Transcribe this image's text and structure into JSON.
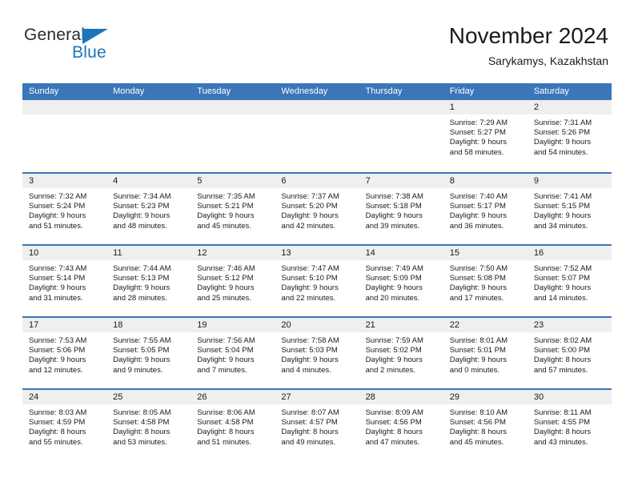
{
  "brand": {
    "word1": "General",
    "word2": "Blue",
    "accent": "#1a75bb"
  },
  "header": {
    "title": "November 2024",
    "location": "Sarykamys, Kazakhstan"
  },
  "theme": {
    "header_blue": "#3a76b8",
    "cell_head_gray": "#efefef"
  },
  "weekdays": [
    "Sunday",
    "Monday",
    "Tuesday",
    "Wednesday",
    "Thursday",
    "Friday",
    "Saturday"
  ],
  "weeks": [
    [
      {
        "day": "",
        "empty": true
      },
      {
        "day": "",
        "empty": true
      },
      {
        "day": "",
        "empty": true
      },
      {
        "day": "",
        "empty": true
      },
      {
        "day": "",
        "empty": true
      },
      {
        "day": "1",
        "sunrise": "Sunrise: 7:29 AM",
        "sunset": "Sunset: 5:27 PM",
        "daylight1": "Daylight: 9 hours",
        "daylight2": "and 58 minutes."
      },
      {
        "day": "2",
        "sunrise": "Sunrise: 7:31 AM",
        "sunset": "Sunset: 5:26 PM",
        "daylight1": "Daylight: 9 hours",
        "daylight2": "and 54 minutes."
      }
    ],
    [
      {
        "day": "3",
        "sunrise": "Sunrise: 7:32 AM",
        "sunset": "Sunset: 5:24 PM",
        "daylight1": "Daylight: 9 hours",
        "daylight2": "and 51 minutes."
      },
      {
        "day": "4",
        "sunrise": "Sunrise: 7:34 AM",
        "sunset": "Sunset: 5:23 PM",
        "daylight1": "Daylight: 9 hours",
        "daylight2": "and 48 minutes."
      },
      {
        "day": "5",
        "sunrise": "Sunrise: 7:35 AM",
        "sunset": "Sunset: 5:21 PM",
        "daylight1": "Daylight: 9 hours",
        "daylight2": "and 45 minutes."
      },
      {
        "day": "6",
        "sunrise": "Sunrise: 7:37 AM",
        "sunset": "Sunset: 5:20 PM",
        "daylight1": "Daylight: 9 hours",
        "daylight2": "and 42 minutes."
      },
      {
        "day": "7",
        "sunrise": "Sunrise: 7:38 AM",
        "sunset": "Sunset: 5:18 PM",
        "daylight1": "Daylight: 9 hours",
        "daylight2": "and 39 minutes."
      },
      {
        "day": "8",
        "sunrise": "Sunrise: 7:40 AM",
        "sunset": "Sunset: 5:17 PM",
        "daylight1": "Daylight: 9 hours",
        "daylight2": "and 36 minutes."
      },
      {
        "day": "9",
        "sunrise": "Sunrise: 7:41 AM",
        "sunset": "Sunset: 5:15 PM",
        "daylight1": "Daylight: 9 hours",
        "daylight2": "and 34 minutes."
      }
    ],
    [
      {
        "day": "10",
        "sunrise": "Sunrise: 7:43 AM",
        "sunset": "Sunset: 5:14 PM",
        "daylight1": "Daylight: 9 hours",
        "daylight2": "and 31 minutes."
      },
      {
        "day": "11",
        "sunrise": "Sunrise: 7:44 AM",
        "sunset": "Sunset: 5:13 PM",
        "daylight1": "Daylight: 9 hours",
        "daylight2": "and 28 minutes."
      },
      {
        "day": "12",
        "sunrise": "Sunrise: 7:46 AM",
        "sunset": "Sunset: 5:12 PM",
        "daylight1": "Daylight: 9 hours",
        "daylight2": "and 25 minutes."
      },
      {
        "day": "13",
        "sunrise": "Sunrise: 7:47 AM",
        "sunset": "Sunset: 5:10 PM",
        "daylight1": "Daylight: 9 hours",
        "daylight2": "and 22 minutes."
      },
      {
        "day": "14",
        "sunrise": "Sunrise: 7:49 AM",
        "sunset": "Sunset: 5:09 PM",
        "daylight1": "Daylight: 9 hours",
        "daylight2": "and 20 minutes."
      },
      {
        "day": "15",
        "sunrise": "Sunrise: 7:50 AM",
        "sunset": "Sunset: 5:08 PM",
        "daylight1": "Daylight: 9 hours",
        "daylight2": "and 17 minutes."
      },
      {
        "day": "16",
        "sunrise": "Sunrise: 7:52 AM",
        "sunset": "Sunset: 5:07 PM",
        "daylight1": "Daylight: 9 hours",
        "daylight2": "and 14 minutes."
      }
    ],
    [
      {
        "day": "17",
        "sunrise": "Sunrise: 7:53 AM",
        "sunset": "Sunset: 5:06 PM",
        "daylight1": "Daylight: 9 hours",
        "daylight2": "and 12 minutes."
      },
      {
        "day": "18",
        "sunrise": "Sunrise: 7:55 AM",
        "sunset": "Sunset: 5:05 PM",
        "daylight1": "Daylight: 9 hours",
        "daylight2": "and 9 minutes."
      },
      {
        "day": "19",
        "sunrise": "Sunrise: 7:56 AM",
        "sunset": "Sunset: 5:04 PM",
        "daylight1": "Daylight: 9 hours",
        "daylight2": "and 7 minutes."
      },
      {
        "day": "20",
        "sunrise": "Sunrise: 7:58 AM",
        "sunset": "Sunset: 5:03 PM",
        "daylight1": "Daylight: 9 hours",
        "daylight2": "and 4 minutes."
      },
      {
        "day": "21",
        "sunrise": "Sunrise: 7:59 AM",
        "sunset": "Sunset: 5:02 PM",
        "daylight1": "Daylight: 9 hours",
        "daylight2": "and 2 minutes."
      },
      {
        "day": "22",
        "sunrise": "Sunrise: 8:01 AM",
        "sunset": "Sunset: 5:01 PM",
        "daylight1": "Daylight: 9 hours",
        "daylight2": "and 0 minutes."
      },
      {
        "day": "23",
        "sunrise": "Sunrise: 8:02 AM",
        "sunset": "Sunset: 5:00 PM",
        "daylight1": "Daylight: 8 hours",
        "daylight2": "and 57 minutes."
      }
    ],
    [
      {
        "day": "24",
        "sunrise": "Sunrise: 8:03 AM",
        "sunset": "Sunset: 4:59 PM",
        "daylight1": "Daylight: 8 hours",
        "daylight2": "and 55 minutes."
      },
      {
        "day": "25",
        "sunrise": "Sunrise: 8:05 AM",
        "sunset": "Sunset: 4:58 PM",
        "daylight1": "Daylight: 8 hours",
        "daylight2": "and 53 minutes."
      },
      {
        "day": "26",
        "sunrise": "Sunrise: 8:06 AM",
        "sunset": "Sunset: 4:58 PM",
        "daylight1": "Daylight: 8 hours",
        "daylight2": "and 51 minutes."
      },
      {
        "day": "27",
        "sunrise": "Sunrise: 8:07 AM",
        "sunset": "Sunset: 4:57 PM",
        "daylight1": "Daylight: 8 hours",
        "daylight2": "and 49 minutes."
      },
      {
        "day": "28",
        "sunrise": "Sunrise: 8:09 AM",
        "sunset": "Sunset: 4:56 PM",
        "daylight1": "Daylight: 8 hours",
        "daylight2": "and 47 minutes."
      },
      {
        "day": "29",
        "sunrise": "Sunrise: 8:10 AM",
        "sunset": "Sunset: 4:56 PM",
        "daylight1": "Daylight: 8 hours",
        "daylight2": "and 45 minutes."
      },
      {
        "day": "30",
        "sunrise": "Sunrise: 8:11 AM",
        "sunset": "Sunset: 4:55 PM",
        "daylight1": "Daylight: 8 hours",
        "daylight2": "and 43 minutes."
      }
    ]
  ]
}
